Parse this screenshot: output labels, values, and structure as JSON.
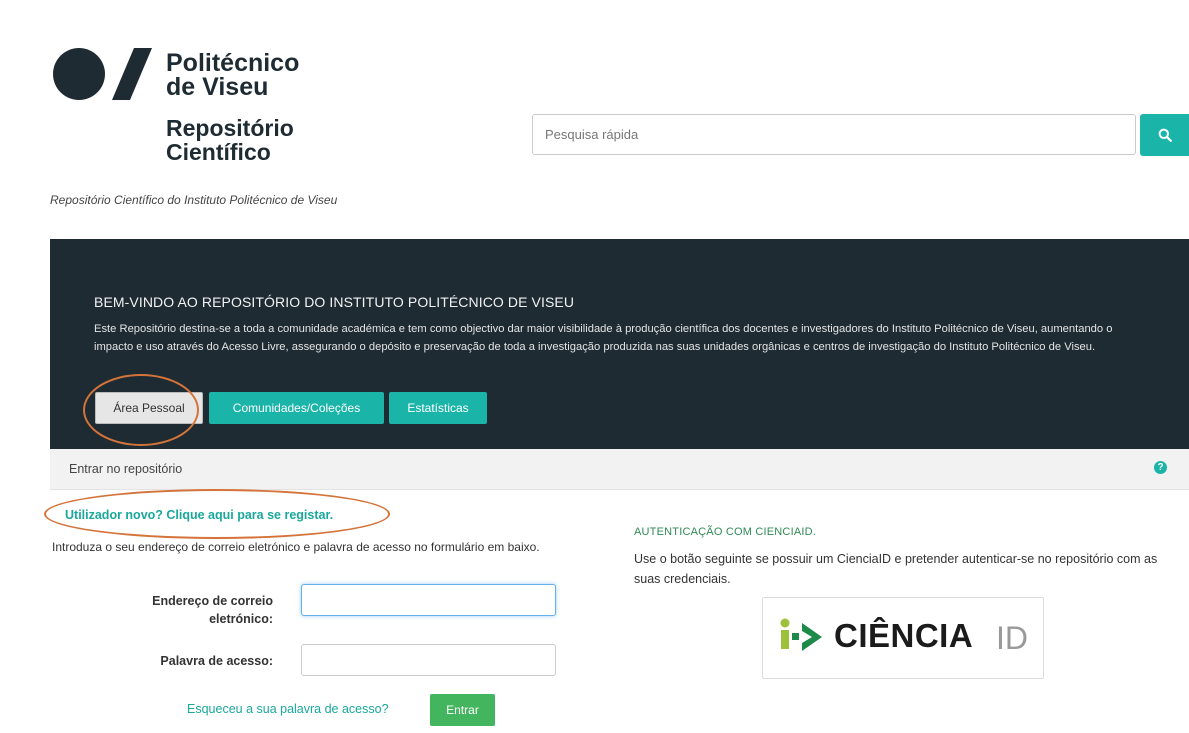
{
  "header": {
    "logo_line1": "Politécnico",
    "logo_line2": "de Viseu",
    "logo_line3": "Repositório",
    "logo_line4": "Científico",
    "subtitle": "Repositório Científico do Instituto Politécnico de Viseu"
  },
  "search": {
    "placeholder": "Pesquisa rápida",
    "icon": "search-icon"
  },
  "banner": {
    "title": "BEM-VINDO AO REPOSITÓRIO DO INSTITUTO POLITÉCNICO DE VISEU",
    "text": "Este Repositório destina-se a toda a comunidade académica e tem como objectivo dar maior visibilidade à produção científica dos docentes e investigadores do Instituto Politécnico de Viseu, aumentando o impacto e uso através do Acesso Livre, assegurando o depósito e preservação de toda a investigação produzida nas suas unidades orgânicas e centros de investigação do Instituto Politécnico de Viseu.",
    "buttons": [
      "Área Pessoal",
      "Comunidades/Coleções",
      "Estatísticas"
    ]
  },
  "login": {
    "strip_title": "Entrar no repositório",
    "help_icon": "?",
    "register_link": "Utilizador novo? Clique aqui para se registar.",
    "intro": "Introduza o seu endereço de correio eletrónico e palavra de acesso no formulário em baixo.",
    "email_label": "Endereço de correio eletrónico:",
    "password_label": "Palavra de acesso:",
    "forgot_link": "Esqueceu a sua palavra de acesso?",
    "submit": "Entrar"
  },
  "cienciaid": {
    "title": "AUTENTICAÇÃO COM CIENCIAID.",
    "text": "Use o botão seguinte se possuir um CienciaID e pretender autenticar-se no repositório com as suas credenciais.",
    "logo_word": "CIÊNCIA",
    "logo_suffix": "ID"
  },
  "colors": {
    "accent": "#1ab5a8",
    "banner_bg": "#1e2b33",
    "annotation": "#d4733a",
    "submit_green": "#44b55f"
  }
}
